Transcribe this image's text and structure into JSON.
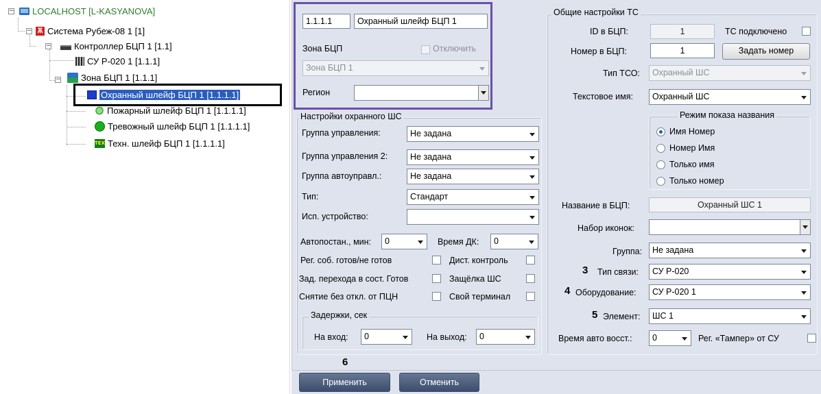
{
  "tree": {
    "nodes": [
      {
        "label": "LOCALHOST [L-KASYANOVA]"
      },
      {
        "label": "Система Рубеж-08 1 [1]"
      },
      {
        "label": "Контроллер БЦП 1 [1.1]"
      },
      {
        "label": "СУ Р-020 1 [1.1.1]"
      },
      {
        "label": "Зона БЦП 1 [1.1.1]"
      },
      {
        "label": "Охранный шлейф БЦП 1 [1.1.1.1]"
      },
      {
        "label": "Пожарный шлейф БЦП 1 [1.1.1.1]"
      },
      {
        "label": "Тревожный шлейф БЦП 1 [1.1.1.1]"
      },
      {
        "label": "Техн. шлейф БЦП 1 [1.1.1.1]"
      }
    ]
  },
  "header": {
    "id_value": "1.1.1.1",
    "name_value": "Охранный шлейф БЦП 1",
    "zone_label": "Зона БЦП",
    "disable_label": "Отключить",
    "zone_value": "Зона БЦП 1",
    "region_label": "Регион",
    "region_value": ""
  },
  "guard": {
    "title": "Настройки охранного ШС",
    "control_group_label": "Группа управления:",
    "control_group_value": "Не задана",
    "control_group2_label": "Группа управления 2:",
    "control_group2_value": "Не задана",
    "auto_group_label": "Группа автоуправл.:",
    "auto_group_value": "Не задана",
    "type_label": "Тип:",
    "type_value": "Стандарт",
    "exec_device_label": "Исп. устройство:",
    "exec_device_value": "",
    "autoset_label": "Автопостан., мин:",
    "autoset_value": "0",
    "dk_time_label": "Время ДК:",
    "dk_time_value": "0",
    "reg_ready_label": "Рег. соб. готов/не готов",
    "remote_control_label": "Дист. контроль",
    "delay_ready_label": "Зад. перехода в сост. Готов",
    "latch_label": "Защёлка ШС",
    "unset_label": "Снятие без откл. от ПЦН",
    "own_terminal_label": "Свой терминал",
    "delays_title": "Задержки, сек",
    "entry_label": "На вход:",
    "entry_value": "0",
    "exit_label": "На выход:",
    "exit_value": "0"
  },
  "general": {
    "title": "Общие настройки ТС",
    "id_label": "ID в БЦП:",
    "id_value": "1",
    "connected_label": "ТС подключено",
    "number_label": "Номер в БЦП:",
    "number_value": "1",
    "set_number_button": "Задать номер",
    "tso_type_label": "Тип ТСО:",
    "tso_type_value": "Охранный ШС",
    "text_name_label": "Текстовое имя:",
    "text_name_value": "Охранный ШС",
    "display_mode_title": "Режим показа названия",
    "display_modes": [
      "Имя Номер",
      "Номер Имя",
      "Только имя",
      "Только номер"
    ],
    "name_in_bcp_label": "Название в БЦП:",
    "name_in_bcp_value": "Охранный ШС 1",
    "icon_set_label": "Набор иконок:",
    "icon_set_value": "",
    "group_label": "Группа:",
    "group_value": "Не задана",
    "link_type_label": "Тип связи:",
    "link_type_value": "СУ Р-020",
    "equipment_label": "Оборудование:",
    "equipment_value": "СУ Р-020 1",
    "element_label": "Элемент:",
    "element_value": "ШС 1",
    "auto_restore_label": "Время авто восст.:",
    "auto_restore_value": "0",
    "tamper_label": "Рег. «Тампер» от СУ"
  },
  "callouts": {
    "n3": "3",
    "n4": "4",
    "n5": "5",
    "n6": "6"
  },
  "footer": {
    "apply": "Применить",
    "cancel": "Отменить"
  },
  "colors": {
    "selection": "#2b5dbf",
    "panel_bg": "#dfe3ee",
    "header_border": "#6a4faa"
  }
}
